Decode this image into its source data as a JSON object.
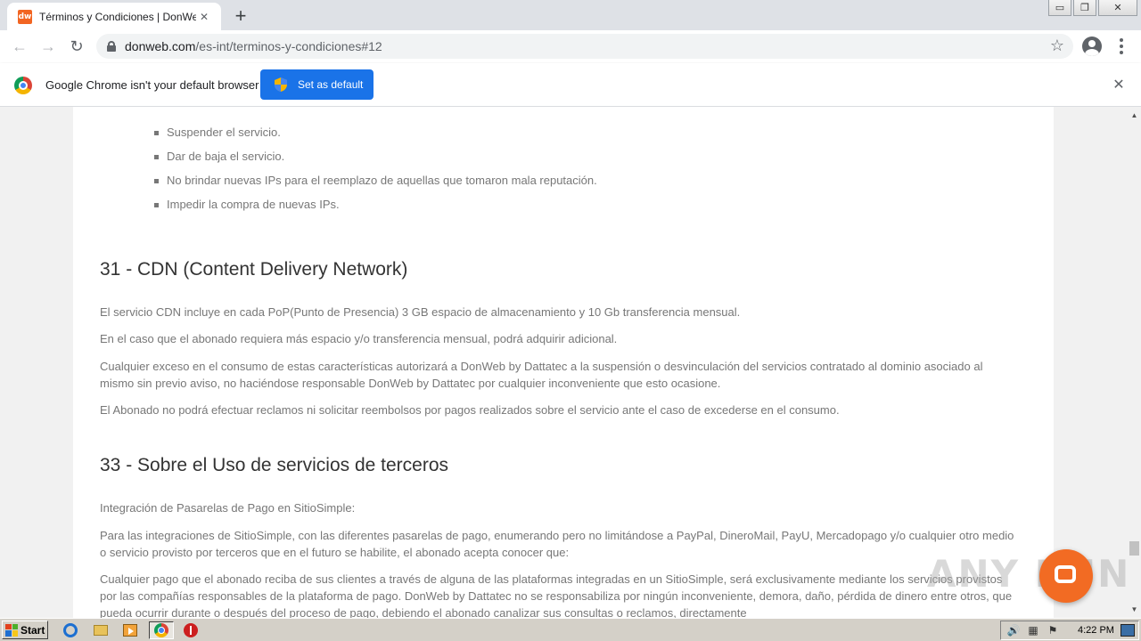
{
  "browser": {
    "tab": {
      "favicon_text": "dw",
      "title": "Términos y Condiciones | DonWeb Int",
      "close_glyph": "✕"
    },
    "new_tab_glyph": "+",
    "window_controls": {
      "minimize": "▭",
      "restore": "❐",
      "close": "✕"
    },
    "nav": {
      "back": "←",
      "forward": "→",
      "reload": "↻"
    },
    "address": {
      "host": "donweb.com",
      "path": "/es-int/terminos-y-condiciones#12"
    },
    "bookmark_glyph": "☆"
  },
  "infobar": {
    "message": "Google Chrome isn't your default browser",
    "button_label": "Set as default",
    "close_glyph": "✕"
  },
  "page": {
    "bullets": [
      "Suspender el servicio.",
      "Dar de baja el servicio.",
      "No brindar nuevas IPs para el reemplazo de aquellas que tomaron mala reputación.",
      "Impedir la compra de nuevas IPs."
    ],
    "section31": {
      "heading": "31 - CDN (Content Delivery Network)",
      "paragraphs": [
        "El servicio CDN incluye en cada PoP(Punto de Presencia) 3 GB espacio de almacenamiento y 10 Gb transferencia mensual.",
        "En el caso que el abonado requiera más espacio y/o transferencia mensual, podrá adquirir adicional.",
        "Cualquier exceso en el consumo de estas características autorizará a DonWeb by Dattatec a la suspensión o desvinculación del servicios contratado al dominio asociado al mismo sin previo aviso, no haciéndose responsable DonWeb by Dattatec por cualquier inconveniente que esto ocasione.",
        "El Abonado no podrá efectuar reclamos ni solicitar reembolsos por pagos realizados sobre el servicio ante el caso de excederse en el consumo."
      ]
    },
    "section33": {
      "heading": "33 - Sobre el Uso de servicios de terceros",
      "paragraphs": [
        "Integración de Pasarelas de Pago en SitioSimple:",
        "Para las integraciones de SitioSimple, con las diferentes pasarelas de pago, enumerando pero no limitándose a PayPal, DineroMail, PayU, Mercadopago y/o cualquier otro medio o servicio provisto por terceros que en el futuro se habilite, el abonado acepta conocer que:",
        "Cualquier pago que el abonado reciba de sus clientes a través de alguna de las plataformas integradas en un SitioSimple, será exclusivamente mediante los servicios provistos por las compañías responsables de la plataforma de pago. DonWeb by Dattatec no se responsabiliza por ningún inconveniente, demora, daño, pérdida de dinero entre otros, que pueda ocurrir durante o después del proceso de pago, debiendo el abonado canalizar sus consultas o reclamos, directamente"
      ]
    }
  },
  "scrollbar": {
    "up_glyph": "▲",
    "down_glyph": "▼"
  },
  "watermark": {
    "text": "ANY RUN"
  },
  "taskbar": {
    "start_label": "Start",
    "clock": "4:22 PM",
    "tray_icons": [
      "speaker-icon",
      "network-icon",
      "flag-icon"
    ]
  },
  "colors": {
    "accent_blue": "#1a73e8",
    "brand_orange": "#f26522",
    "heading_text": "#333333",
    "body_text": "#777777"
  }
}
